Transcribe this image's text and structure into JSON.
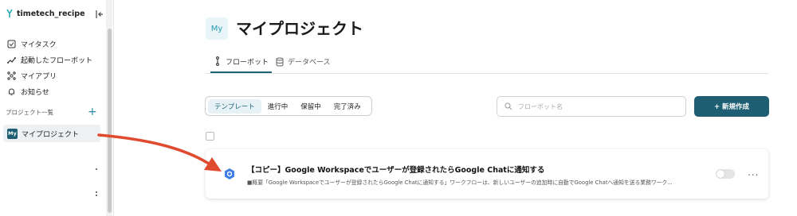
{
  "sidebar": {
    "brand": "timetech_recipe",
    "nav": [
      {
        "label": "マイタスク",
        "icon": "task-check-icon"
      },
      {
        "label": "起動したフローボット",
        "icon": "flowbot-run-icon"
      },
      {
        "label": "マイアプリ",
        "icon": "apps-icon"
      },
      {
        "label": "お知らせ",
        "icon": "bell-icon"
      }
    ],
    "section_label": "プロジェクト一覧",
    "add_symbol": "+",
    "project": {
      "badge": "My",
      "name": "マイプロジェクト"
    }
  },
  "main": {
    "page_icon": "My",
    "title": "マイプロジェクト",
    "tabs": [
      {
        "label": "フローボット",
        "active": true
      },
      {
        "label": "データベース",
        "active": false
      }
    ],
    "filters": [
      "テンプレート",
      "進行中",
      "保留中",
      "完了済み"
    ],
    "search_placeholder": "フローボット名",
    "new_button": "+ 新規作成",
    "card": {
      "title": "【コピー】Google Workspaceでユーザーが登録されたらGoogle Chatに通知する",
      "description": "■概要「Google Workspaceでユーザーが登録されたらGoogle Chatに通知する」ワークフローは、新しいユーザーの追加時に自動でGoogle Chatへ通知を送る業務ワーク...",
      "enabled": false,
      "more": "..."
    }
  },
  "colors": {
    "accent": "#1d5e72",
    "arrow": "#e04a2f"
  }
}
